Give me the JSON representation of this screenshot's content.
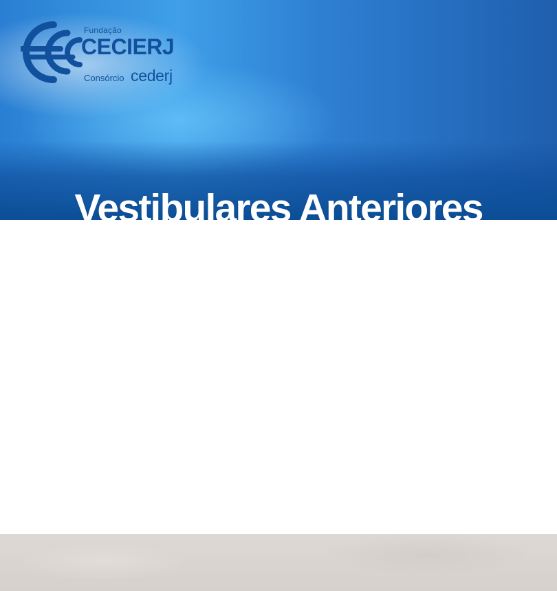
{
  "brand": {
    "fundacao": "Fundação",
    "cecierj": "CECIERJ",
    "consorcio": "Consórcio",
    "cederj": "cederj",
    "primary_color": "#11509c"
  },
  "header": {
    "title": "Vestibulares Anteriores"
  }
}
